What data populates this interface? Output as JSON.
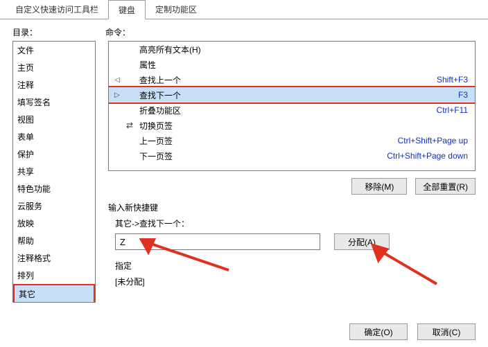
{
  "tabs": {
    "t0": "自定义快速访问工具栏",
    "t1": "键盘",
    "t2": "定制功能区"
  },
  "labels": {
    "dir": "目录：",
    "cmd": "命令：",
    "newsc": "输入新快捷键",
    "assigned": "指定",
    "assigned_val": "[未分配]"
  },
  "dir_items": [
    "文件",
    "主页",
    "注释",
    "填写签名",
    "视图",
    "表单",
    "保护",
    "共享",
    "特色功能",
    "云服务",
    "放映",
    "帮助",
    "注释格式",
    "排列",
    "其它"
  ],
  "cmd_items": [
    {
      "arrow": "",
      "icon": "",
      "txt": "高亮所有文本(H)",
      "sc": ""
    },
    {
      "arrow": "",
      "icon": "",
      "txt": "属性",
      "sc": ""
    },
    {
      "arrow": "◁",
      "icon": "",
      "txt": "查找上一个",
      "sc": "Shift+F3"
    },
    {
      "arrow": "▷",
      "icon": "",
      "txt": "查找下一个",
      "sc": "F3"
    },
    {
      "arrow": "",
      "icon": "",
      "txt": "折叠功能区",
      "sc": "Ctrl+F11"
    },
    {
      "arrow": "",
      "icon": "⇄",
      "txt": "切换页签",
      "sc": ""
    },
    {
      "arrow": "",
      "icon": "",
      "txt": "上一页签",
      "sc": "Ctrl+Shift+Page up"
    },
    {
      "arrow": "",
      "icon": "",
      "txt": "下一页签",
      "sc": "Ctrl+Shift+Page down"
    }
  ],
  "path": "其它->查找下一个：",
  "input_val": "Z",
  "buttons": {
    "remove": "移除(M)",
    "resetall": "全部重置(R)",
    "assign": "分配(A)",
    "ok": "确定(O)",
    "cancel": "取消(C)"
  }
}
